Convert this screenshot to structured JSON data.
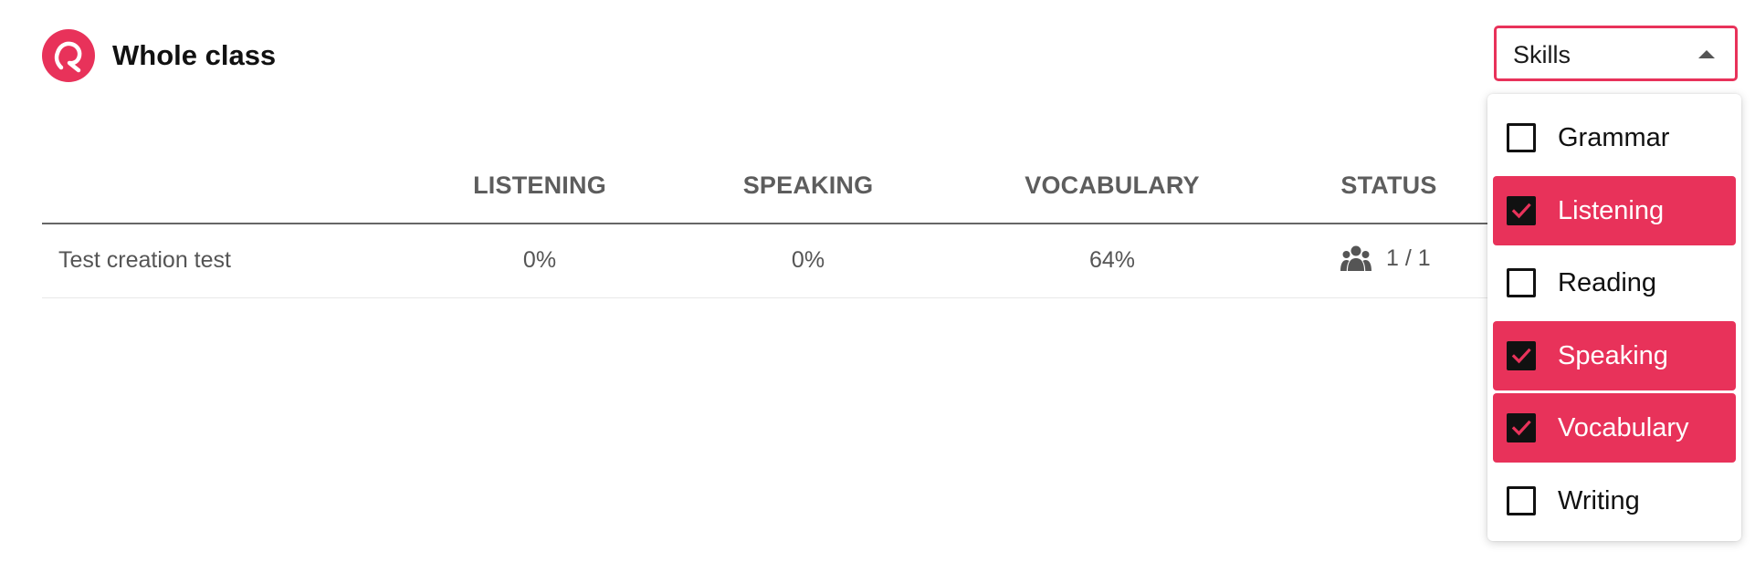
{
  "header": {
    "title": "Whole class",
    "logo_icon": "rg-logo-icon",
    "brand_color": "#e8325a"
  },
  "skills_select": {
    "value": "Skills",
    "arrow_icon": "caret-up-icon"
  },
  "table": {
    "columns": [
      "LISTENING",
      "SPEAKING",
      "VOCABULARY",
      "STATUS"
    ],
    "rows": [
      {
        "name": "Test creation test",
        "listening": "0%",
        "speaking": "0%",
        "vocabulary": "64%",
        "status_icon": "people-group-icon",
        "status": "1 / 1"
      }
    ]
  },
  "skills_menu": {
    "items": [
      {
        "label": "Grammar",
        "checked": false
      },
      {
        "label": "Listening",
        "checked": true
      },
      {
        "label": "Reading",
        "checked": false
      },
      {
        "label": "Speaking",
        "checked": true
      },
      {
        "label": "Vocabulary",
        "checked": true
      },
      {
        "label": "Writing",
        "checked": false
      }
    ]
  }
}
